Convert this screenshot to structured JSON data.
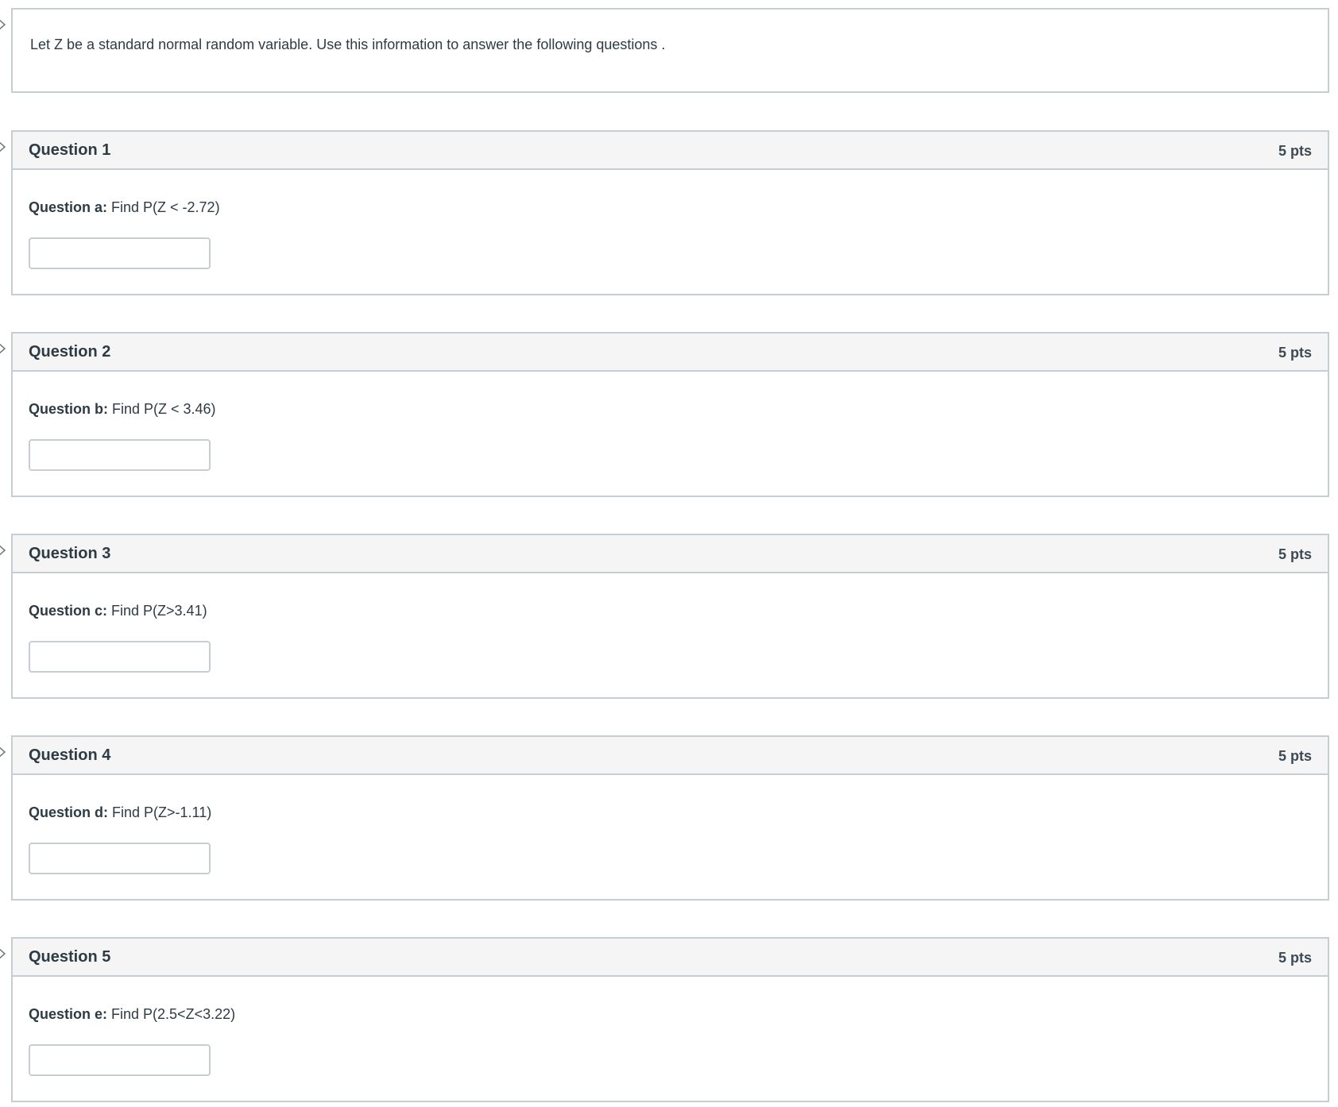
{
  "intro": {
    "text": "Let Z be a standard normal random variable.  Use this information to answer the following questions ."
  },
  "questions": [
    {
      "title": "Question 1",
      "points": "5 pts",
      "prefix": "Question a:",
      "text": " Find P(Z < -2.72)",
      "answer_value": ""
    },
    {
      "title": "Question 2",
      "points": "5 pts",
      "prefix": "Question b:",
      "text": " Find P(Z < 3.46)",
      "answer_value": ""
    },
    {
      "title": "Question 3",
      "points": "5 pts",
      "prefix": "Question c:",
      "text": " Find P(Z>3.41)",
      "answer_value": ""
    },
    {
      "title": "Question 4",
      "points": "5 pts",
      "prefix": "Question d:",
      "text": " Find P(Z>-1.11)",
      "answer_value": ""
    },
    {
      "title": "Question 5",
      "points": "5 pts",
      "prefix": "Question e:",
      "text": " Find P(2.5<Z<3.22)",
      "answer_value": ""
    }
  ],
  "icons": {
    "flag": "flag-icon"
  },
  "colors": {
    "border": "#c7cdd1",
    "header_bg": "#f5f5f5",
    "text": "#2d3b45"
  }
}
